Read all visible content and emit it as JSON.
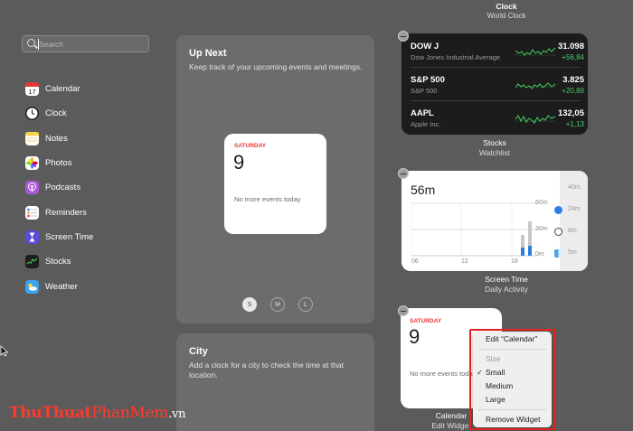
{
  "top_widget": {
    "title": "Clock",
    "subtitle": "World Clock"
  },
  "sidebar": {
    "search": {
      "placeholder": "Search",
      "value": ""
    },
    "items": [
      {
        "label": "Calendar",
        "icon": "calendar-icon",
        "color": "#ffffff"
      },
      {
        "label": "Clock",
        "icon": "clock-icon",
        "color": "#1d1d1d"
      },
      {
        "label": "Notes",
        "icon": "notes-icon",
        "color": "#f7d147"
      },
      {
        "label": "Photos",
        "icon": "photos-icon",
        "color": "#ffffff"
      },
      {
        "label": "Podcasts",
        "icon": "podcasts-icon",
        "color": "#a85ad6"
      },
      {
        "label": "Reminders",
        "icon": "reminders-icon",
        "color": "#ffffff"
      },
      {
        "label": "Screen Time",
        "icon": "hourglass-icon",
        "color": "#5a4bd8"
      },
      {
        "label": "Stocks",
        "icon": "stocks-icon",
        "color": "#1d1d1d"
      },
      {
        "label": "Weather",
        "icon": "weather-icon",
        "color": "#3aa3f0"
      }
    ]
  },
  "gallery": {
    "up_next": {
      "title": "Up Next",
      "description": "Keep track of your upcoming events and meetings.",
      "preview": {
        "day": "SATURDAY",
        "date": "9",
        "events": "No more events today"
      },
      "sizes": [
        "S",
        "M",
        "L"
      ],
      "selected_size": "S"
    },
    "city": {
      "title": "City",
      "description": "Add a clock for a city to check the time at that location."
    }
  },
  "widgets": {
    "stocks": {
      "title": "Stocks",
      "subtitle": "Watchlist",
      "rows": [
        {
          "symbol": "DOW J",
          "name": "Dow Jones Industrial Average",
          "price": "31.098",
          "change": "+56,84"
        },
        {
          "symbol": "S&P 500",
          "name": "S&P 500",
          "price": "3.825",
          "change": "+20,89"
        },
        {
          "symbol": "AAPL",
          "name": "Apple Inc.",
          "price": "132,05",
          "change": "+1,13"
        }
      ],
      "positive_color": "#43d165"
    },
    "screen_time": {
      "title": "Screen Time",
      "subtitle": "Daily Activity",
      "total": "56m",
      "y_ticks": [
        "60m",
        "30m",
        "0m"
      ],
      "x_ticks": [
        "06",
        "12",
        "18"
      ],
      "apps": [
        {
          "icon": "safari-icon",
          "time": "40m"
        },
        {
          "icon": "safari-icon",
          "time": "24m"
        },
        {
          "icon": "chatgpt-icon",
          "time": "8m"
        },
        {
          "icon": "finder-icon",
          "time": "5m"
        }
      ],
      "bar_color": "#2a7ee4"
    },
    "calendar": {
      "title": "Calendar",
      "subtitle": "Edit Widget",
      "day": "SATURDAY",
      "date": "9",
      "events": "No more events today"
    }
  },
  "context_menu": {
    "edit": "Edit “Calendar”",
    "size_header": "Size",
    "sizes": [
      {
        "label": "Small",
        "checked": true
      },
      {
        "label": "Medium",
        "checked": false
      },
      {
        "label": "Large",
        "checked": false
      }
    ],
    "check_mark": "✓",
    "remove": "Remove Widget",
    "highlight_color": "#e0241f"
  },
  "watermark": {
    "part1": "Thu",
    "part2": "Thuat",
    "part3": "PhanMem",
    "part4": ".vn"
  }
}
